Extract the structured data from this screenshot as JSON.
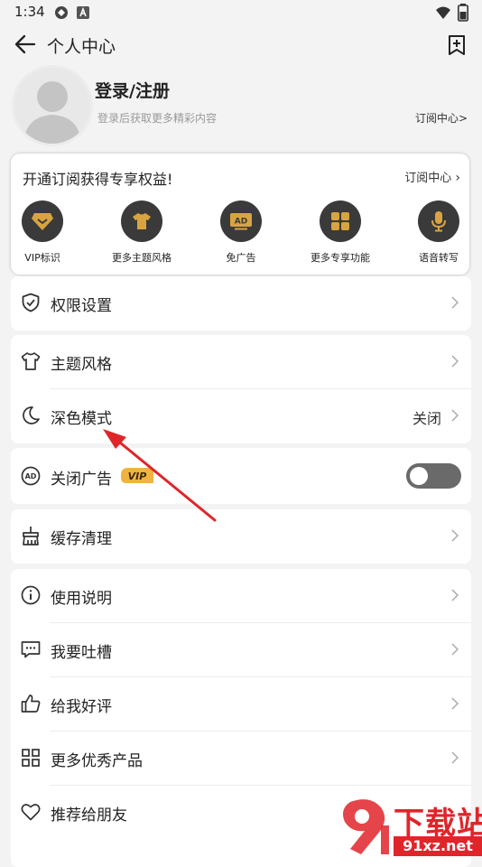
{
  "status_bar": {
    "time": "1:34"
  },
  "header": {
    "title": "个人中心"
  },
  "profile": {
    "title": "登录/注册",
    "subtitle": "登录后获取更多精彩内容",
    "link": "订阅中心>"
  },
  "vip_card": {
    "title": "开通订阅获得专享权益!",
    "link": "订阅中心",
    "items": [
      {
        "label": "VIP标识",
        "icon": "vip-diamond-icon"
      },
      {
        "label": "更多主题风格",
        "icon": "tshirt-icon"
      },
      {
        "label": "免广告",
        "icon": "ad-icon"
      },
      {
        "label": "更多专享功能",
        "icon": "grid-icon"
      },
      {
        "label": "语音转写",
        "icon": "microphone-icon"
      }
    ]
  },
  "menu": {
    "permissions": {
      "label": "权限设置",
      "icon": "shield-check-icon"
    },
    "theme": {
      "label": "主题风格",
      "icon": "tshirt-icon"
    },
    "dark_mode": {
      "label": "深色模式",
      "value": "关闭",
      "icon": "moon-icon"
    },
    "close_ads": {
      "label": "关闭广告",
      "badge": "VIP",
      "toggle_on": false,
      "icon": "ad-icon"
    },
    "cache": {
      "label": "缓存清理",
      "icon": "broom-icon"
    },
    "instructions": {
      "label": "使用说明",
      "icon": "info-icon"
    },
    "feedback": {
      "label": "我要吐槽",
      "icon": "message-icon"
    },
    "rate": {
      "label": "给我好评",
      "icon": "thumbs-up-icon"
    },
    "more_products": {
      "label": "更多优秀产品",
      "icon": "apps-icon"
    },
    "recommend": {
      "label": "推荐给朋友",
      "icon": "heart-icon"
    }
  },
  "watermark": {
    "text": "下载站",
    "domain": "91xz.net"
  },
  "colors": {
    "accent": "#d9a440",
    "dark": "#3a3a3a",
    "annotation_arrow": "#e0252a"
  }
}
